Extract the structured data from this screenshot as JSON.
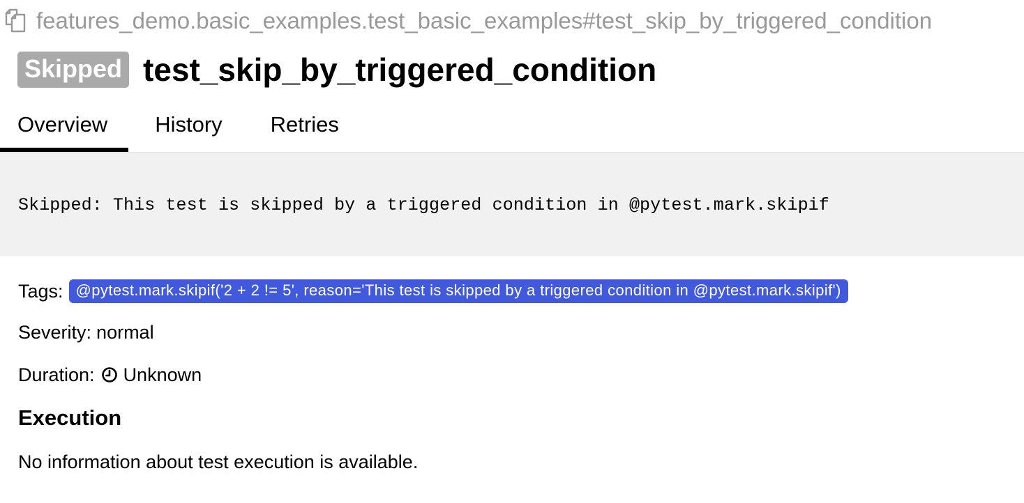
{
  "header": {
    "full_name": "features_demo.basic_examples.test_basic_examples#test_skip_by_triggered_condition",
    "copy_icon": "copy-icon",
    "status": "Skipped",
    "status_color": "#aaaaaa",
    "title": "test_skip_by_triggered_condition"
  },
  "tabs": [
    {
      "label": "Overview",
      "active": true
    },
    {
      "label": "History",
      "active": false
    },
    {
      "label": "Retries",
      "active": false
    }
  ],
  "status_message": "Skipped: This test is skipped by a triggered condition in @pytest.mark.skipif",
  "details": {
    "tags_label": "Tags:",
    "tags": [
      "@pytest.mark.skipif('2 + 2 != 5', reason='This test is skipped by a triggered condition in @pytest.mark.skipif')"
    ],
    "tag_color": "#4059dd",
    "severity_label": "Severity:",
    "severity_value": "normal",
    "duration_label": "Duration:",
    "duration_icon": "clock-icon",
    "duration_value": "Unknown"
  },
  "execution": {
    "title": "Execution",
    "message": "No information about test execution is available."
  }
}
